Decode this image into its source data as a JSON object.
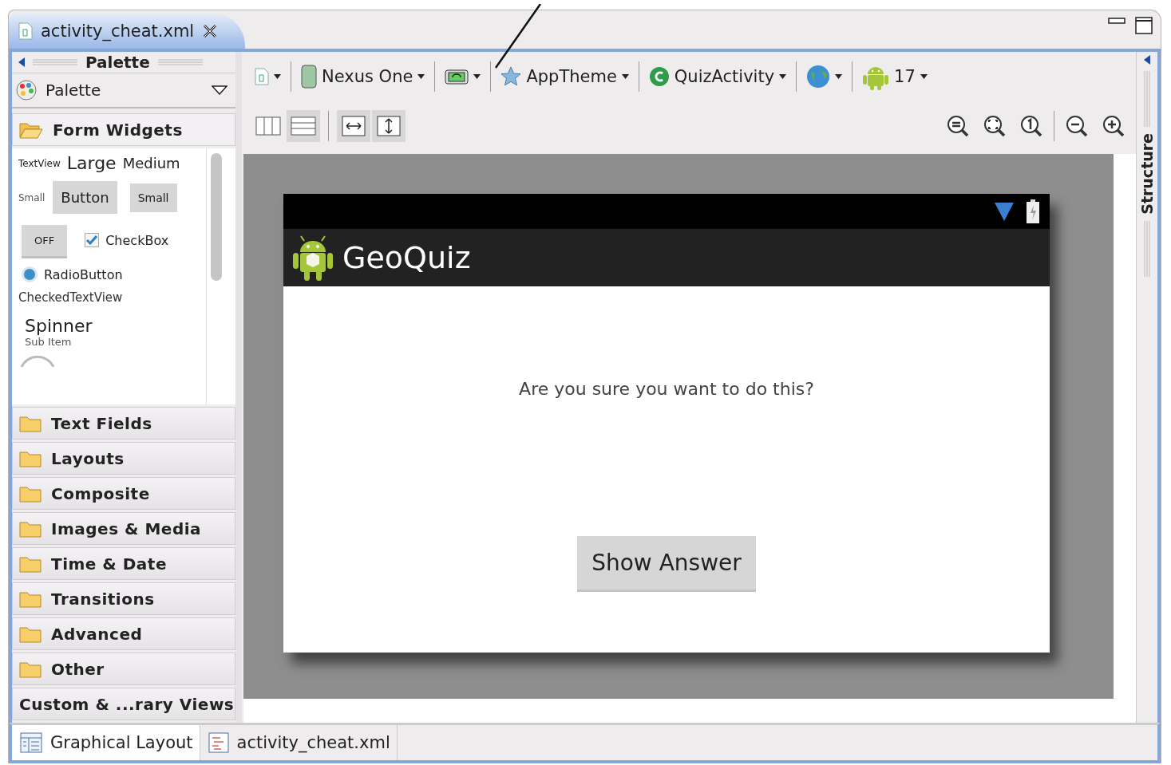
{
  "editor_tabs": [
    {
      "label": "activity_cheat.xml",
      "selected": true
    }
  ],
  "palette": {
    "title": "Palette",
    "dropdown": "Palette",
    "sections": [
      {
        "kind": "folder",
        "label": "Form Widgets",
        "expanded": true,
        "rows": [
          [
            {
              "kind": "text-tiny",
              "label": "TextView"
            },
            {
              "kind": "text-large",
              "label": "Large"
            },
            {
              "kind": "text-medium",
              "label": "Medium"
            }
          ],
          [
            {
              "kind": "text-small",
              "label": "Small"
            },
            {
              "kind": "button",
              "label": "Button"
            },
            {
              "kind": "button-small",
              "label": "Small"
            }
          ],
          [
            {
              "kind": "toggle",
              "label": "OFF"
            },
            {
              "kind": "checkbox",
              "label": "CheckBox",
              "checked": true
            }
          ],
          [
            {
              "kind": "radio",
              "label": "RadioButton",
              "selected": true
            }
          ],
          [
            {
              "kind": "text-plain",
              "label": "CheckedTextView"
            }
          ],
          [
            {
              "kind": "spinner",
              "label": "Spinner",
              "sub": "Sub Item"
            }
          ],
          [
            {
              "kind": "progress"
            }
          ]
        ]
      },
      {
        "kind": "folder",
        "label": "Text Fields",
        "expanded": false
      },
      {
        "kind": "folder",
        "label": "Layouts",
        "expanded": false
      },
      {
        "kind": "folder",
        "label": "Composite",
        "expanded": false
      },
      {
        "kind": "folder",
        "label": "Images & Media",
        "expanded": false
      },
      {
        "kind": "folder",
        "label": "Time & Date",
        "expanded": false
      },
      {
        "kind": "folder",
        "label": "Transitions",
        "expanded": false
      },
      {
        "kind": "folder",
        "label": "Advanced",
        "expanded": false
      },
      {
        "kind": "folder",
        "label": "Other",
        "expanded": false
      },
      {
        "kind": "plain",
        "label": "Custom & ...rary Views",
        "expanded": false
      }
    ]
  },
  "toolbar": [
    {
      "kind": "layout-file"
    },
    {
      "kind": "device",
      "label": "Nexus One"
    },
    {
      "kind": "orientation"
    },
    {
      "kind": "theme",
      "label": "AppTheme"
    },
    {
      "kind": "activity",
      "label": "QuizActivity"
    },
    {
      "kind": "locale"
    },
    {
      "kind": "api",
      "label": "17"
    }
  ],
  "view_toggles": [
    [
      {
        "kind": "columns",
        "selected": false
      },
      {
        "kind": "rows",
        "selected": true
      }
    ],
    [
      {
        "kind": "fit-width",
        "selected": true
      },
      {
        "kind": "fit-height",
        "selected": true
      }
    ]
  ],
  "zoom_buttons": [
    [
      {
        "kind": "zoom-real"
      },
      {
        "kind": "zoom-fit"
      },
      {
        "kind": "zoom-100"
      }
    ],
    [
      {
        "kind": "zoom-out"
      },
      {
        "kind": "zoom-in"
      }
    ]
  ],
  "device": {
    "app_title": "GeoQuiz",
    "question": "Are you sure you want to do this?",
    "button": "Show Answer"
  },
  "side_panel": {
    "title": "Structure"
  },
  "bottom_tabs": [
    {
      "kind": "layout",
      "label": "Graphical Layout",
      "selected": true
    },
    {
      "kind": "xml",
      "label": "activity_cheat.xml",
      "selected": false
    }
  ]
}
